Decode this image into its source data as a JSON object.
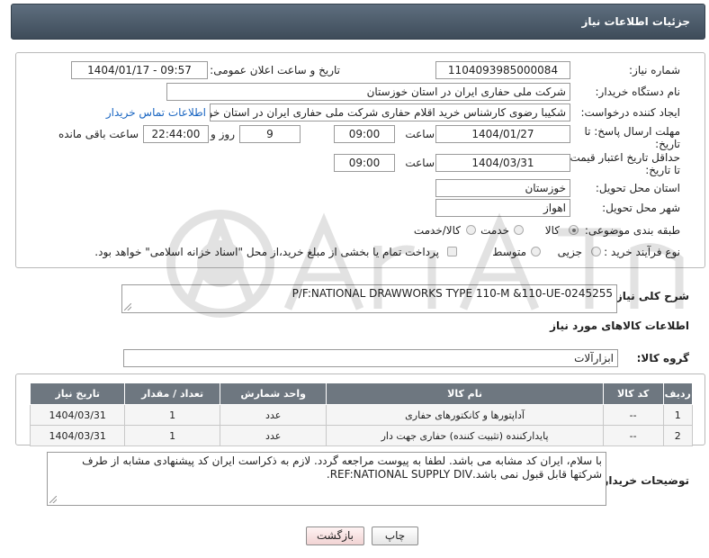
{
  "header": {
    "title": "جزئیات اطلاعات نیاز"
  },
  "fields": {
    "need_number": {
      "label": "شماره نیاز:",
      "value": "1104093985000084"
    },
    "announce_datetime": {
      "label": "تاریخ و ساعت اعلان عمومی:",
      "value": "1404/01/17 - 09:57"
    },
    "buyer_org": {
      "label": "نام دستگاه خریدار:",
      "value": "شرکت ملی حفاری ایران در استان خوزستان"
    },
    "requester": {
      "label": "ایجاد کننده درخواست:",
      "value": "شکیبا رضوی کارشناس خرید اقلام حفاری شرکت ملی حفاری ایران در استان خو",
      "link": "اطلاعات تماس خریدار"
    },
    "reply_deadline": {
      "label_line1": "مهلت ارسال پاسخ: تا",
      "label_line2": "تاریخ:",
      "date": "1404/01/27",
      "time_label": "ساعت",
      "time": "09:00",
      "days": "9",
      "days_label": "روز و",
      "remaining": "22:44:00",
      "remaining_label": "ساعت باقی مانده"
    },
    "price_validity": {
      "label_line1": "حداقل تاریخ اعتبار قیمت:",
      "label_line2": "تا تاریخ:",
      "date": "1404/03/31",
      "time_label": "ساعت",
      "time": "09:00"
    },
    "delivery_province": {
      "label": "استان محل تحویل:",
      "value": "خوزستان"
    },
    "delivery_city": {
      "label": "شهر محل تحویل:",
      "value": "اهواز"
    },
    "category": {
      "label": "طبقه بندی موضوعی:",
      "options": [
        "کالا",
        "خدمت",
        "کالا/خدمت"
      ],
      "selected": "کالا"
    },
    "purchase_type": {
      "label": "نوع فرآیند خرید :",
      "options": [
        "جزیی",
        "متوسط"
      ],
      "selected": "متوسط",
      "note": "پرداخت تمام یا بخشی از مبلغ خرید،از محل \"اسناد خزانه اسلامی\" خواهد بود."
    }
  },
  "description": {
    "label": "شرح کلی نیاز:",
    "value": "P/F:NATIONAL DRAWWORKS TYPE 110-M &110-UE-0245255"
  },
  "items_section": {
    "title": "اطلاعات کالاهای مورد نیاز",
    "group_label": "گروه کالا:",
    "group_value": "ابزارآلات"
  },
  "table": {
    "headers": [
      "ردیف",
      "کد کالا",
      "نام کالا",
      "واحد شمارش",
      "تعداد / مقدار",
      "تاریخ نیاز"
    ],
    "rows": [
      [
        "1",
        "--",
        "آداپتورها و کانکتورهای حفاری",
        "عدد",
        "1",
        "1404/03/31"
      ],
      [
        "2",
        "--",
        "پایدارکننده (تثبیت کننده) حفاری جهت دار",
        "عدد",
        "1",
        "1404/03/31"
      ]
    ]
  },
  "buyer_notes": {
    "label": "توضیحات خریدار:",
    "value": "با سلام، ایران کد مشابه می باشد. لطفا به پیوست مراجعه گردد. لازم به ذکراست ایران کد پیشنهادی مشابه از طرف شرکتها قابل قبول نمی باشد.REF:NATIONAL SUPPLY DIV."
  },
  "buttons": {
    "print": "چاپ",
    "back": "بازگشت"
  },
  "colors": {
    "header": "#4d5b69",
    "table_header": "#6e7780",
    "link": "#1a66c2"
  }
}
